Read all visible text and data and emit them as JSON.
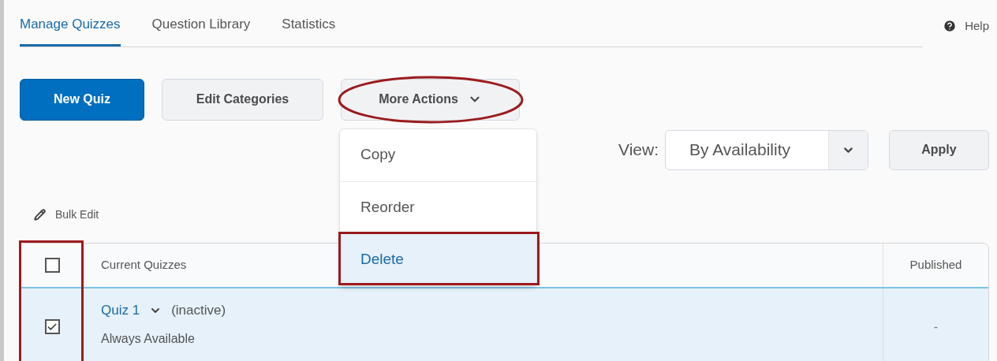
{
  "tabs": [
    {
      "label": "Manage Quizzes",
      "selected": true
    },
    {
      "label": "Question Library",
      "selected": false
    },
    {
      "label": "Statistics",
      "selected": false
    }
  ],
  "help": {
    "label": "Help"
  },
  "toolbar": {
    "buttons": [
      {
        "label": "New Quiz",
        "kind": "primary"
      },
      {
        "label": "Edit Categories",
        "kind": "secondary"
      },
      {
        "label": "More Actions",
        "kind": "menu"
      }
    ]
  },
  "more_actions_menu": {
    "items": [
      {
        "label": "Copy",
        "selected": false
      },
      {
        "label": "Reorder",
        "selected": false
      },
      {
        "label": "Delete",
        "selected": true
      }
    ]
  },
  "view": {
    "label": "View:",
    "value": "By Availability"
  },
  "apply_button": {
    "label": "Apply"
  },
  "bulk_edit": {
    "label": "Bulk Edit"
  },
  "table": {
    "select_all_checked": false,
    "columns": [
      "Current Quizzes",
      "Published"
    ],
    "rows": [
      {
        "checked": true,
        "selected": true,
        "name": "Quiz 1",
        "status": "(inactive)",
        "availability": "Always Available",
        "published": "-"
      }
    ]
  }
}
